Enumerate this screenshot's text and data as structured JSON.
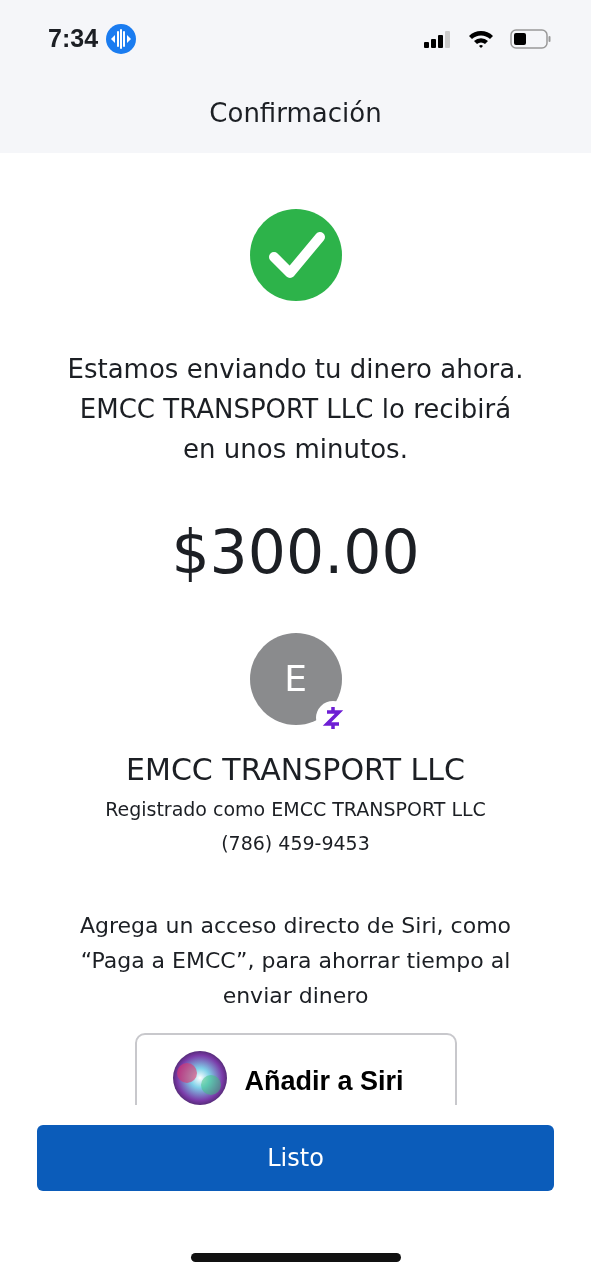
{
  "status_bar": {
    "time": "7:34"
  },
  "header": {
    "title": "Confirmación"
  },
  "message": "Estamos enviando tu dinero ahora. EMCC TRANSPORT LLC lo recibirá en unos minutos.",
  "amount": "$300.00",
  "recipient": {
    "initial": "E",
    "name": "EMCC TRANSPORT LLC",
    "registered": "Registrado como EMCC TRANSPORT LLC",
    "phone": "(786) 459-9453"
  },
  "siri": {
    "text": "Agrega un acceso directo de Siri, como “Paga a EMCC”, para ahorrar tiempo al enviar dinero",
    "button": "Añadir a Siri"
  },
  "primary_button": "Listo"
}
